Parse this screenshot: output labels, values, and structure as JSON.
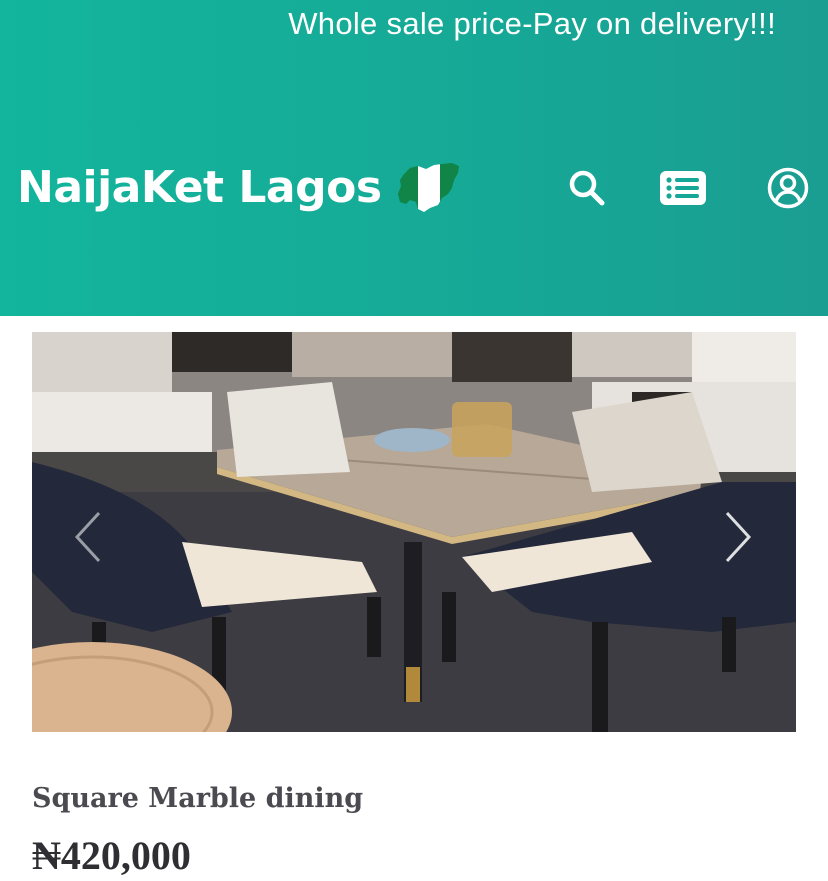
{
  "header": {
    "announcement": "Whole sale price-Pay on delivery!!!",
    "brand_name": "NaijaKet Lagos",
    "background_color": "#16a896",
    "icons": [
      "search-icon",
      "menu-list-icon",
      "account-icon"
    ]
  },
  "product": {
    "title": "Square Marble dining",
    "price": "₦420,000"
  },
  "carousel": {
    "prev_icon": "chevron-left-icon",
    "next_icon": "chevron-right-icon"
  }
}
